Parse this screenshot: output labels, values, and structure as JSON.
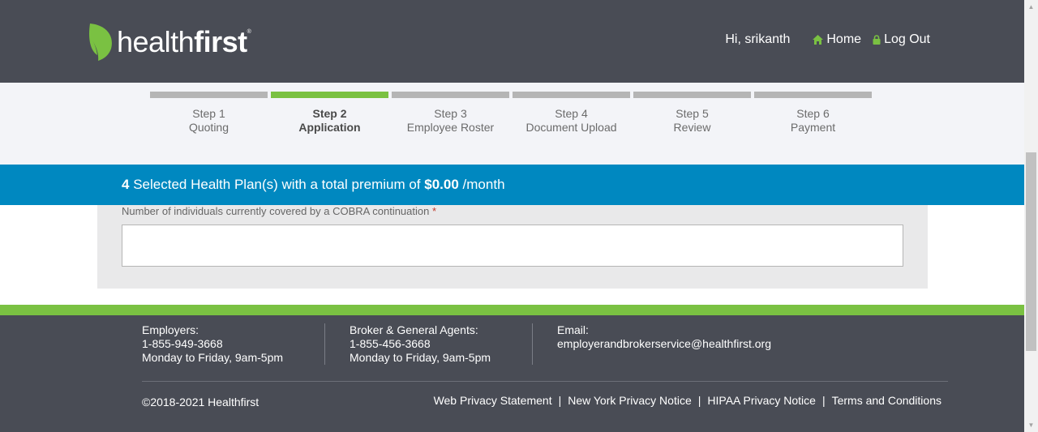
{
  "header": {
    "logo_light": "health",
    "logo_bold": "first",
    "logo_mark": "®",
    "greeting": "Hi, srikanth",
    "home_icon": "home-icon",
    "home_label": "Home",
    "lock_icon": "lock-icon",
    "logout_label": "Log Out"
  },
  "steps": [
    {
      "num": "Step 1",
      "name": "Quoting"
    },
    {
      "num": "Step 2",
      "name": "Application"
    },
    {
      "num": "Step 3",
      "name": "Employee Roster"
    },
    {
      "num": "Step 4",
      "name": "Document Upload"
    },
    {
      "num": "Step 5",
      "name": "Review"
    },
    {
      "num": "Step 6",
      "name": "Payment"
    }
  ],
  "active_step": 2,
  "banner": {
    "count": "4",
    "text_mid": "Selected Health Plan(s) with a total premium of",
    "amount": "$0.00",
    "suffix": "/month"
  },
  "form": {
    "cobra_label": "Number of individuals currently covered by a COBRA continuation",
    "required_mark": "*",
    "cobra_value": ""
  },
  "footer": {
    "employers_title": "Employers:",
    "employers_phone": "1-855-949-3668",
    "employers_hours": "Monday to Friday, 9am-5pm",
    "broker_title": "Broker & General Agents:",
    "broker_phone": "1-855-456-3668",
    "broker_hours": "Monday to Friday, 9am-5pm",
    "email_title": "Email:",
    "email": "employerandbrokerservice@healthfirst.org",
    "copyright": "©2018-2021 Healthfirst",
    "links": [
      "Web Privacy Statement",
      "New York Privacy Notice",
      "HIPAA Privacy Notice",
      "Terms and Conditions"
    ]
  },
  "colors": {
    "header_bg": "#494c55",
    "accent_green": "#7ac142",
    "banner_blue": "#0088c0"
  }
}
